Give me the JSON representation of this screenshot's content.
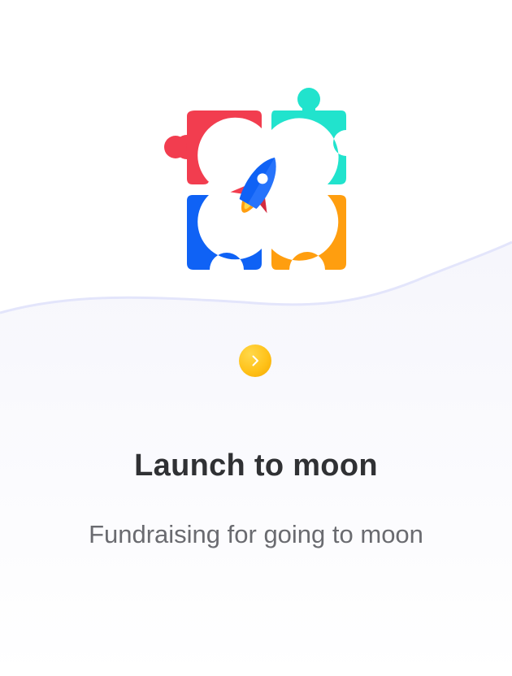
{
  "onboarding": {
    "title": "Launch to moon",
    "subtitle": "Fundraising for going to moon"
  },
  "icons": {
    "logo": "puzzle-rocket-logo",
    "next": "chevron-right-icon"
  },
  "colors": {
    "puzzle_red": "#f23d4f",
    "puzzle_teal": "#21e3cd",
    "puzzle_blue": "#0f62f5",
    "puzzle_orange": "#ff9e0f",
    "next_button": "#ffc21a",
    "wave_line": "#e3e5fb",
    "lower_background": "#f7f7fc",
    "title_text": "#303134",
    "subtitle_text": "#6a6b70"
  }
}
